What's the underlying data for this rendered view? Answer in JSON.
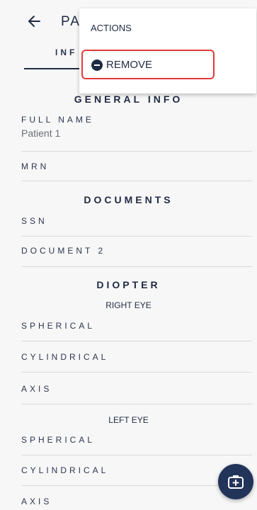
{
  "header": {
    "title": "PA",
    "tab_label": "INF"
  },
  "menu": {
    "header": "ACTIONS",
    "remove_label": "REMOVE"
  },
  "general_info": {
    "title": "GENERAL INFO",
    "full_name_label": "FULL NAME",
    "full_name_value": "Patient 1",
    "mrn_label": "MRN"
  },
  "documents": {
    "title": "DOCUMENTS",
    "ssn_label": "SSN",
    "doc2_label": "DOCUMENT 2"
  },
  "diopter": {
    "title": "DIOPTER",
    "right_eye": "RIGHT EYE",
    "left_eye": "LEFT EYE",
    "spherical": "SPHERICAL",
    "cylindrical": "CYLINDRICAL",
    "axis": "AXIS"
  },
  "colors": {
    "accent": "#1f2a44",
    "highlight": "#e33b3b",
    "fab": "#23345a"
  }
}
